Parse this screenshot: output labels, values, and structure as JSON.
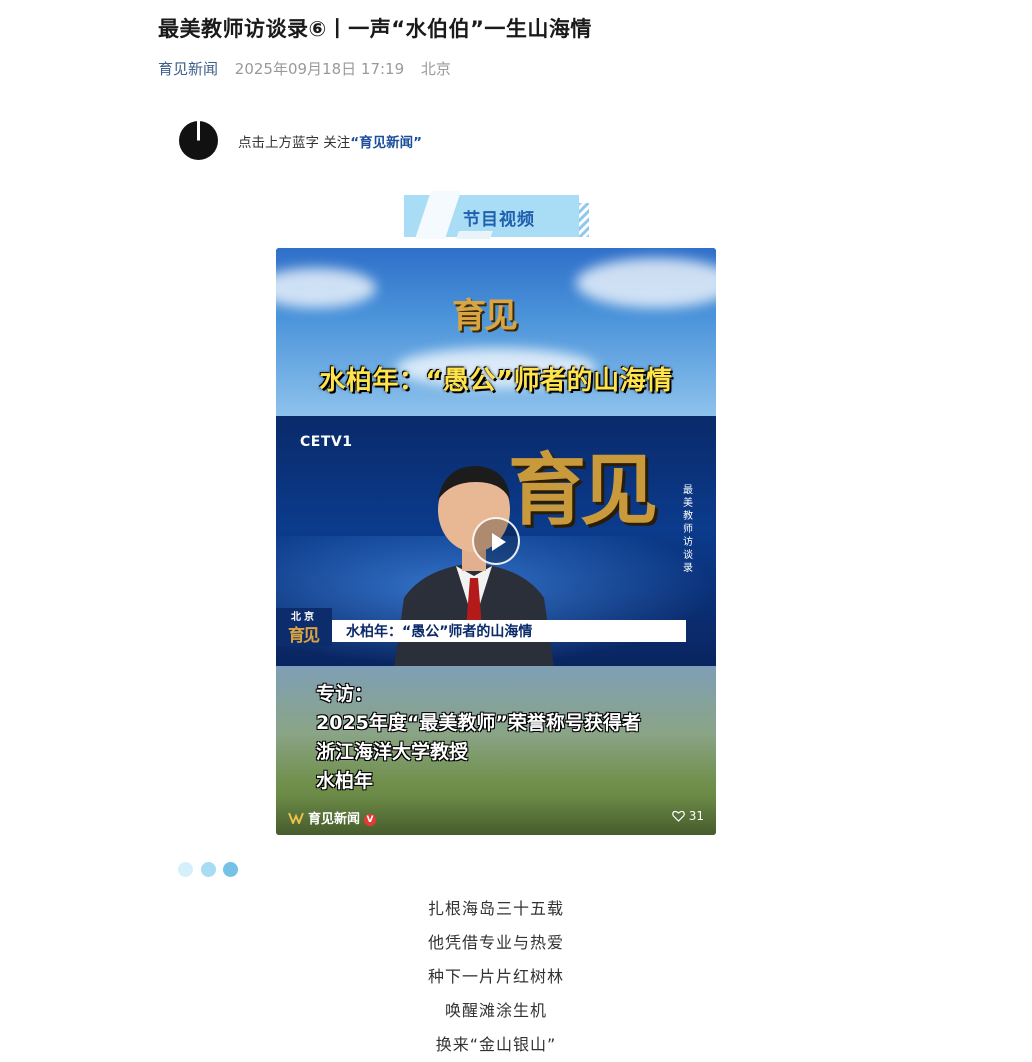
{
  "article": {
    "title": "最美教师访谈录⑥丨一声“水伯伯”一生山海情",
    "account": "育见新闻",
    "date": "2025年09月18日 17:19",
    "location": "北京"
  },
  "follow": {
    "prompt": "点击上方蓝字 关注",
    "account": "“育见新闻”"
  },
  "section": {
    "label": "节目视频"
  },
  "video": {
    "logo": "育见",
    "headline": "水柏年：“愚公”师者的山海情",
    "channel_logo": "CETV1",
    "studio_logo": "育见",
    "vertical_text": "最美教师访谈录",
    "lower_third_location": "北京",
    "lower_third_logo": "育见",
    "lower_third_text": "水柏年：“愚公”师者的山海情",
    "interview_lines": [
      "专访：",
      "2025年度“最美教师”荣誉称号获得者",
      "浙江海洋大学教授",
      "水柏年"
    ],
    "channel_name": "育见新闻",
    "verified_badge": "V",
    "likes": "31"
  },
  "poem": [
    "扎根海岛三十五载",
    "他凭借专业与热爱",
    "种下一片片红树林",
    "唤醒滩涂生机",
    "换来“金山银山”"
  ],
  "colors": {
    "account_link": "#3e5f8a",
    "follow_account": "#1d4f9a",
    "section_label": "#1f5fae",
    "dot_light": "#d6f0fb",
    "dot_mid": "#a7dcf3",
    "dot_dark": "#74c2e8"
  }
}
